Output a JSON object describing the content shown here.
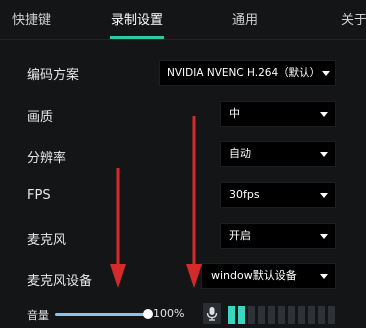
{
  "tabs": [
    {
      "label": "快捷键"
    },
    {
      "label": "录制设置"
    },
    {
      "label": "通用"
    },
    {
      "label": "关于"
    }
  ],
  "active_tab": "录制设置",
  "colors": {
    "background": "#131517",
    "accent_underline": "#2ec7a9",
    "annotation_arrow": "#d42a2a",
    "meter_on": "#39d7c0",
    "slider": "#8fc2e8"
  },
  "settings": {
    "encoder": {
      "label": "编码方案",
      "value": "NVIDIA NVENC H.264（默认）"
    },
    "quality": {
      "label": "画质",
      "value": "中"
    },
    "resolution": {
      "label": "分辨率",
      "value": "自动"
    },
    "fps": {
      "label": "FPS",
      "value": "30fps"
    },
    "mic": {
      "label": "麦克风",
      "value": "开启"
    },
    "mic_device": {
      "label": "麦克风设备",
      "value": "window默认设备"
    }
  },
  "volume": {
    "label": "音量",
    "percent_text": "100%",
    "level": 1.0,
    "mic_icon": "microphone-icon",
    "meter_lit_bars": 2,
    "meter_total_bars": 11
  }
}
